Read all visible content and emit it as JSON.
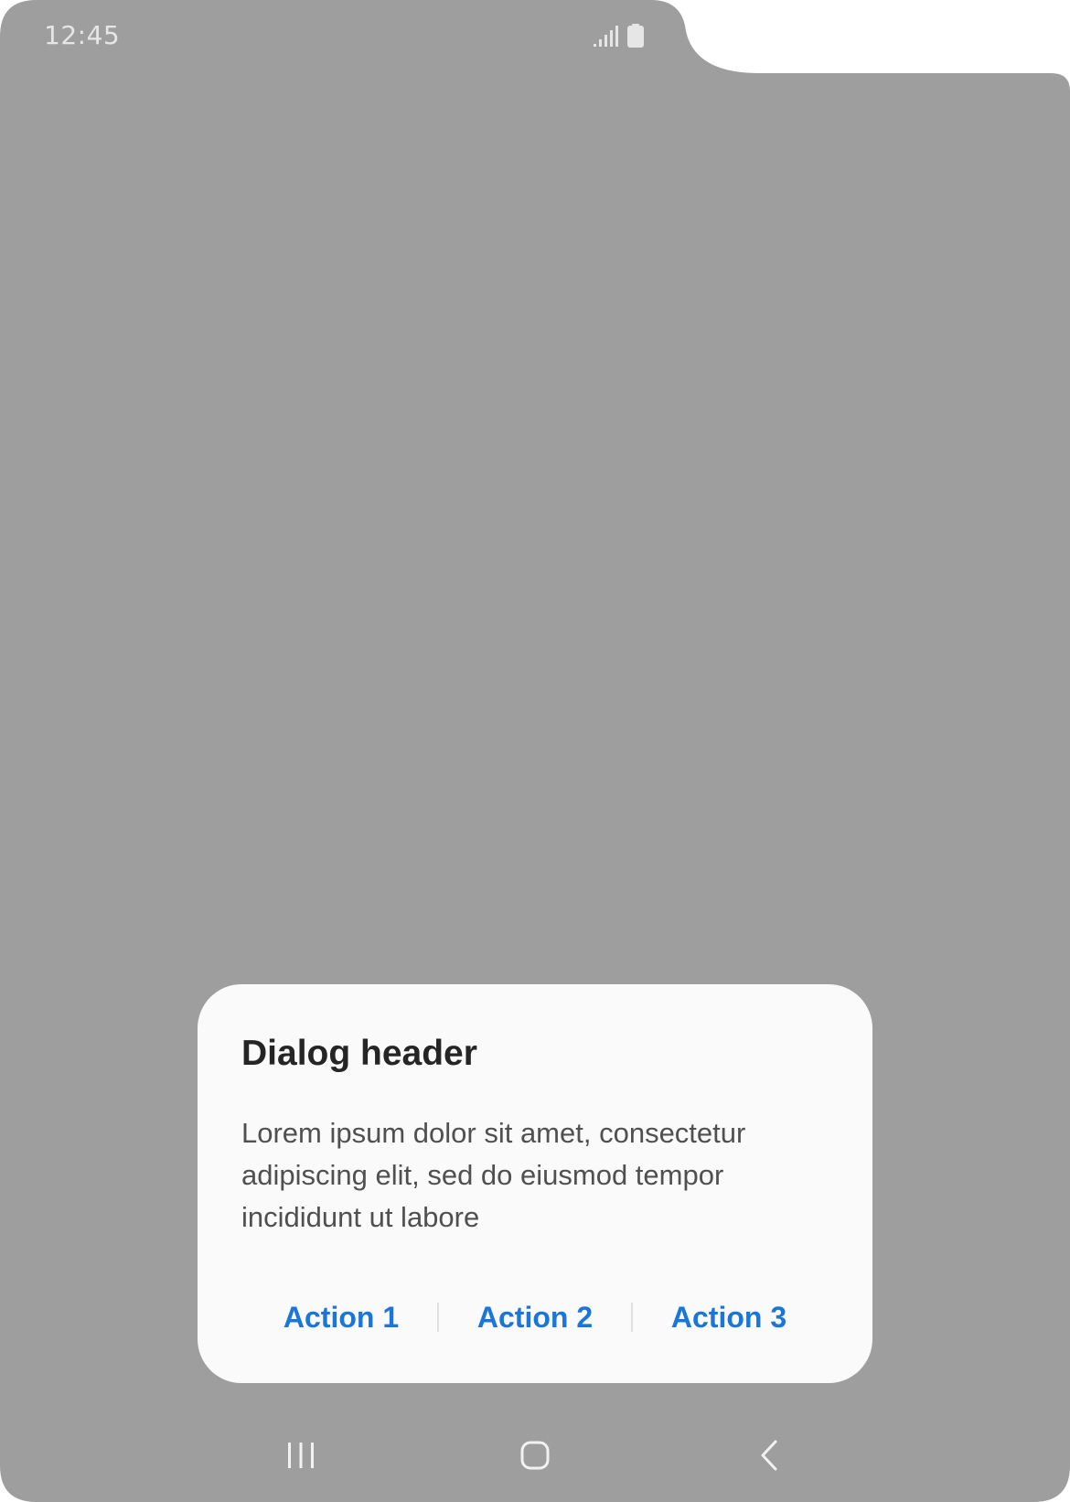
{
  "status_bar": {
    "time": "12:45",
    "icons": [
      "signal-icon",
      "battery-icon"
    ]
  },
  "dialog": {
    "title": "Dialog header",
    "body": "Lorem ipsum dolor sit amet, consectetur adipiscing elit, sed do eiusmod tempor incididunt ut labore",
    "actions": [
      {
        "label": "Action 1"
      },
      {
        "label": "Action 2"
      },
      {
        "label": "Action 3"
      }
    ]
  },
  "nav_bar": {
    "icons": [
      "recent-apps-icon",
      "home-icon",
      "back-icon"
    ]
  },
  "colors": {
    "scrim": "#9e9e9e",
    "dialog_background": "#fafafa",
    "accent": "#1b76d6",
    "title_text": "#252525",
    "body_text": "#505050"
  }
}
